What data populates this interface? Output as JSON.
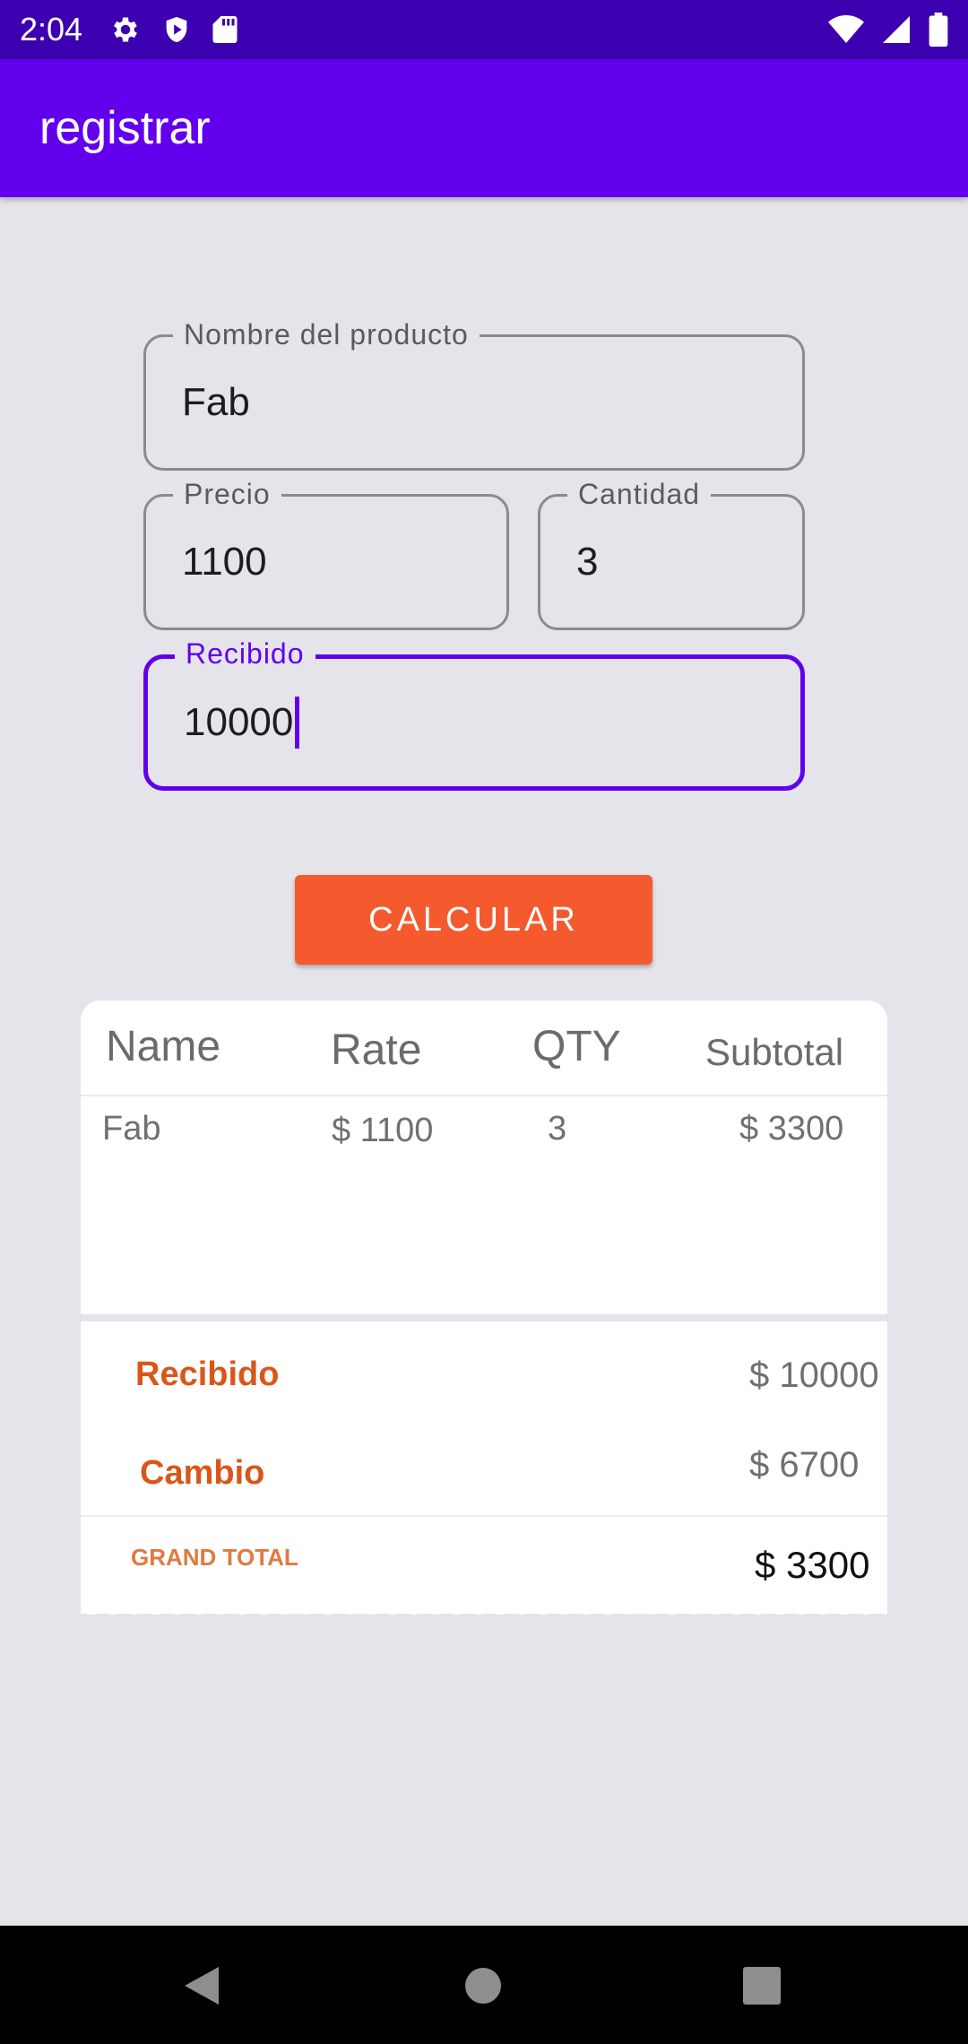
{
  "status_bar": {
    "time": "2:04",
    "icons_left": [
      "gear-icon",
      "shield-icon",
      "sd-card-icon"
    ],
    "icons_right": [
      "wifi-icon",
      "signal-icon",
      "battery-icon"
    ]
  },
  "app_bar": {
    "title": "registrar"
  },
  "form": {
    "product_name": {
      "label": "Nombre del producto",
      "value": "Fab"
    },
    "price": {
      "label": "Precio",
      "value": "1100"
    },
    "quantity": {
      "label": "Cantidad",
      "value": "3"
    },
    "received": {
      "label": "Recibido",
      "value": "10000"
    }
  },
  "calc_button": {
    "label": "CALCULAR"
  },
  "receipt": {
    "columns": [
      "Name",
      "Rate",
      "QTY",
      "Subtotal"
    ],
    "rows": [
      {
        "name": "Fab",
        "rate": "$ 1100",
        "qty": "3",
        "subtotal": "$ 3300"
      }
    ],
    "received_label": "Recibido",
    "received_value": "$ 10000",
    "change_label": "Cambio",
    "change_value": "$ 6700",
    "grand_total_label": "GRAND TOTAL",
    "grand_total_value": "$ 3300"
  },
  "nav_bar": {
    "icons": [
      "back-icon",
      "home-icon",
      "recents-icon"
    ]
  },
  "colors": {
    "status_bar": "#3d00b0",
    "app_bar": "#6200ee",
    "accent": "#6200ee",
    "button": "#f45a2d",
    "summary_label": "#d9561a",
    "background": "#e4e4ea"
  }
}
